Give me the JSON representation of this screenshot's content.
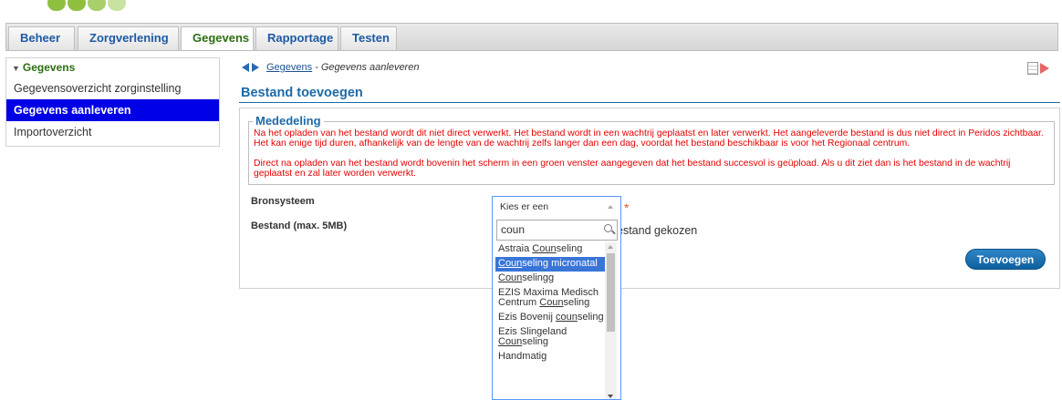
{
  "tabs": [
    {
      "label": "Beheer",
      "active": false
    },
    {
      "label": "Zorgverlening",
      "active": false
    },
    {
      "label": "Gegevens",
      "active": true
    },
    {
      "label": "Rapportage",
      "active": false
    },
    {
      "label": "Testen",
      "active": false
    }
  ],
  "sidebar": {
    "header": "Gegevens",
    "items": [
      {
        "label": "Gegevensoverzicht zorginstelling",
        "active": false
      },
      {
        "label": "Gegevens aanleveren",
        "active": true
      },
      {
        "label": "Importoverzicht",
        "active": false
      }
    ]
  },
  "breadcrumb": {
    "link": "Gegevens",
    "separator": "-",
    "current": "Gegevens aanleveren"
  },
  "page_title": "Bestand toevoegen",
  "notice": {
    "legend": "Mededeling",
    "paragraph1": "Na het opladen van het bestand wordt dit niet direct verwerkt. Het bestand wordt in een wachtrij geplaatst en later verwerkt. Het aangeleverde bestand is dus niet direct in Peridos zichtbaar. Het kan enige tijd duren, afhankelijk van de lengte van de wachtrij zelfs langer dan een dag, voordat het bestand beschikbaar is voor het Regionaal centrum.",
    "paragraph2": "Direct na opladen van het bestand wordt bovenin het scherm in een groen venster aangegeven dat het bestand succesvol is geüpload. Als u dit ziet dan is het bestand in de wachtrij geplaatst en zal later worden verwerkt."
  },
  "form": {
    "source_label": "Bronsysteem",
    "file_label": "Bestand (max. 5MB)",
    "required_mark": "*",
    "file_status": "estand gekozen",
    "submit_label": "Toevoegen"
  },
  "dropdown": {
    "placeholder": "Kies er een",
    "search_value": "coun",
    "options": [
      {
        "before": "Astraia ",
        "match": "Coun",
        "after": "seling",
        "highlighted": false
      },
      {
        "before": "",
        "match": "Coun",
        "after": "seling micronatal",
        "highlighted": true
      },
      {
        "before": "",
        "match": "Coun",
        "after": "selingg",
        "highlighted": false
      },
      {
        "before": "EZIS Maxima Medisch Centrum ",
        "match": "Coun",
        "after": "seling",
        "highlighted": false
      },
      {
        "before": "Ezis Bovenij ",
        "match": "coun",
        "after": "seling",
        "highlighted": false
      },
      {
        "before": "Ezis Slingeland ",
        "match": "Coun",
        "after": "seling",
        "highlighted": false
      },
      {
        "before": "Handmatig",
        "match": "",
        "after": "",
        "highlighted": false
      }
    ]
  },
  "colors": {
    "accent_blue": "#1d6aa8",
    "active_sidebar": "#0000e6",
    "notice_red": "#e60000",
    "highlight": "#3875d7"
  }
}
